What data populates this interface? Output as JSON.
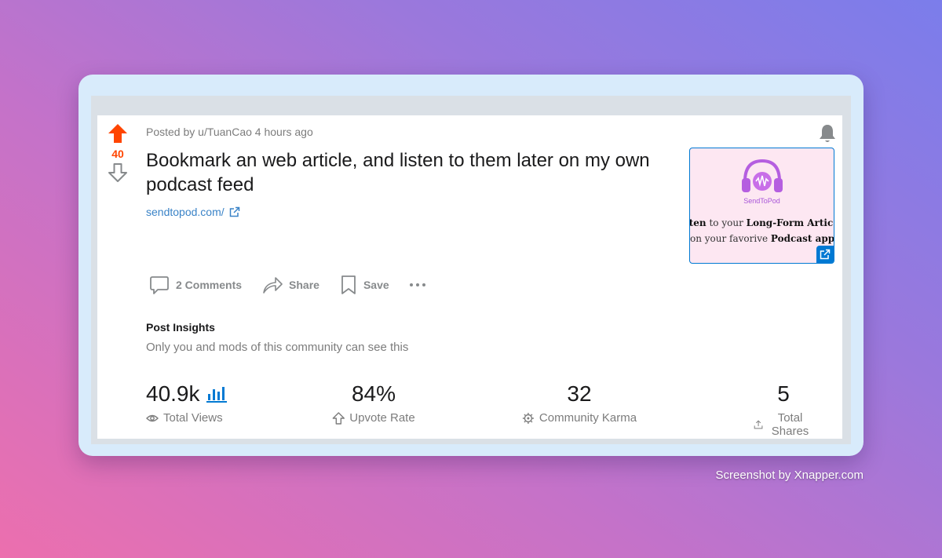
{
  "post": {
    "score": "40",
    "meta": "Posted by u/TuanCao 4 hours ago",
    "title": "Bookmark an web article, and listen to them later on my own podcast feed",
    "link": "sendtopod.com/",
    "thumbnail": {
      "brand": "SendToPod",
      "line1_a": "sten",
      "line1_b": " to your ",
      "line1_c": "Long-Form Artic",
      "line2_a": "on your favorive ",
      "line2_b": "Podcast app"
    }
  },
  "actions": {
    "comments": "2 Comments",
    "share": "Share",
    "save": "Save"
  },
  "insights": {
    "title": "Post Insights",
    "subtitle": "Only you and mods of this community can see this",
    "stats": [
      {
        "value": "40.9k",
        "label": "Total Views"
      },
      {
        "value": "84%",
        "label": "Upvote Rate"
      },
      {
        "value": "32",
        "label": "Community Karma"
      },
      {
        "value": "5",
        "label": "Total Shares"
      }
    ]
  },
  "watermark": "Screenshot by Xnapper.com",
  "colors": {
    "upvote": "#ff4500",
    "link": "#3a83c7",
    "accent": "#0079d3"
  }
}
